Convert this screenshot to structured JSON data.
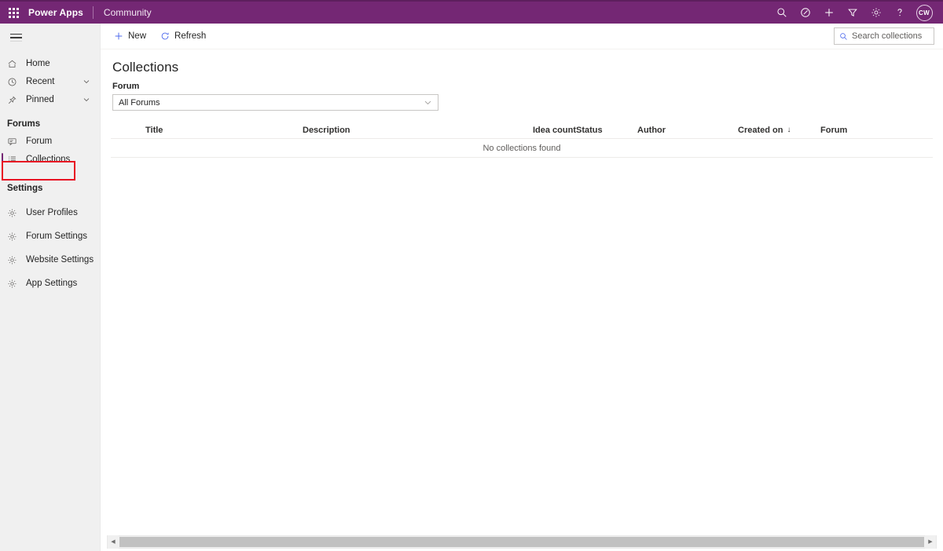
{
  "header": {
    "waffle_label": "app-launcher",
    "brand": "Power Apps",
    "app_name": "Community",
    "icons": [
      {
        "name": "search-icon",
        "glyph": "search"
      },
      {
        "name": "assistant-icon",
        "glyph": "compass"
      },
      {
        "name": "add-icon",
        "glyph": "plus"
      },
      {
        "name": "filter-icon",
        "glyph": "funnel"
      },
      {
        "name": "settings-gear-icon",
        "glyph": "gear"
      },
      {
        "name": "help-icon",
        "glyph": "question"
      }
    ],
    "avatar_initials": "CW"
  },
  "sidebar": {
    "hamburger_label": "site-map-toggle",
    "top_items": [
      {
        "label": "Home",
        "icon": "home-icon",
        "expandable": false
      },
      {
        "label": "Recent",
        "icon": "clock-icon",
        "expandable": true
      },
      {
        "label": "Pinned",
        "icon": "pin-icon",
        "expandable": true
      }
    ],
    "groups": [
      {
        "title": "Forums",
        "items": [
          {
            "label": "Forum",
            "icon": "chat-bubble-icon",
            "selected": false
          },
          {
            "label": "Collections",
            "icon": "list-icon",
            "selected": true
          }
        ]
      },
      {
        "title": "Settings",
        "items": [
          {
            "label": "User Profiles",
            "icon": "gear-icon",
            "selected": false
          },
          {
            "label": "Forum Settings",
            "icon": "gear-icon",
            "selected": false
          },
          {
            "label": "Website Settings",
            "icon": "gear-icon",
            "selected": false
          },
          {
            "label": "App Settings",
            "icon": "gear-icon",
            "selected": false
          }
        ]
      }
    ],
    "annotation": {
      "target": "Collections",
      "color": "#e81123"
    }
  },
  "commandbar": {
    "new_label": "New",
    "refresh_label": "Refresh"
  },
  "search": {
    "placeholder": "Search collections",
    "value": ""
  },
  "main": {
    "title": "Collections",
    "filter": {
      "label": "Forum",
      "selected": "All Forums"
    },
    "table": {
      "columns": [
        {
          "label": "Title",
          "align": "left"
        },
        {
          "label": "Description",
          "align": "left"
        },
        {
          "label": "Idea count",
          "align": "right"
        },
        {
          "label": "Status",
          "align": "left"
        },
        {
          "label": "Author",
          "align": "left"
        },
        {
          "label": "Created on",
          "align": "left",
          "sort": "↓"
        },
        {
          "label": "Forum",
          "align": "left"
        }
      ],
      "rows": [],
      "empty_message": "No collections found"
    }
  },
  "scrollbar": {
    "left_arrow": "◀",
    "right_arrow": "▶"
  },
  "colors": {
    "brand_purple": "#742774",
    "accent_blue": "#4f6bed",
    "annotation_red": "#e81123",
    "selection_bar": "#742774"
  }
}
